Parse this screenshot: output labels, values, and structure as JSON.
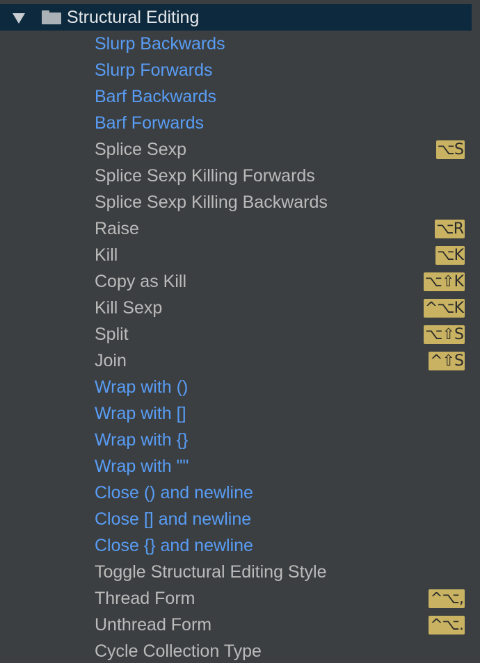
{
  "group": {
    "title": "Structural Editing",
    "expand_icon": "triangle-down",
    "folder_icon": "folder"
  },
  "colors": {
    "header_bg": "#0d293e",
    "panel_bg": "#3c3f41",
    "modified_text": "#589df6",
    "normal_text": "#bbbbbb",
    "shortcut_bg": "#c9b362"
  },
  "actions": [
    {
      "label": "Slurp Backwards",
      "modified": true,
      "shortcut": ""
    },
    {
      "label": "Slurp Forwards",
      "modified": true,
      "shortcut": ""
    },
    {
      "label": "Barf Backwards",
      "modified": true,
      "shortcut": ""
    },
    {
      "label": "Barf Forwards",
      "modified": true,
      "shortcut": ""
    },
    {
      "label": "Splice Sexp",
      "modified": false,
      "shortcut": "⌥S"
    },
    {
      "label": "Splice Sexp Killing Forwards",
      "modified": false,
      "shortcut": ""
    },
    {
      "label": "Splice Sexp Killing Backwards",
      "modified": false,
      "shortcut": ""
    },
    {
      "label": "Raise",
      "modified": false,
      "shortcut": "⌥R"
    },
    {
      "label": "Kill",
      "modified": false,
      "shortcut": "⌥K"
    },
    {
      "label": "Copy as Kill",
      "modified": false,
      "shortcut": "⌥⇧K"
    },
    {
      "label": "Kill Sexp",
      "modified": false,
      "shortcut": "^⌥K"
    },
    {
      "label": "Split",
      "modified": false,
      "shortcut": "⌥⇧S"
    },
    {
      "label": "Join",
      "modified": false,
      "shortcut": "^⇧S"
    },
    {
      "label": "Wrap with ()",
      "modified": true,
      "shortcut": ""
    },
    {
      "label": "Wrap with []",
      "modified": true,
      "shortcut": ""
    },
    {
      "label": "Wrap with {}",
      "modified": true,
      "shortcut": ""
    },
    {
      "label": "Wrap with \"\"",
      "modified": true,
      "shortcut": ""
    },
    {
      "label": "Close () and newline",
      "modified": true,
      "shortcut": ""
    },
    {
      "label": "Close [] and newline",
      "modified": true,
      "shortcut": ""
    },
    {
      "label": "Close {} and newline",
      "modified": true,
      "shortcut": ""
    },
    {
      "label": "Toggle Structural Editing Style",
      "modified": false,
      "shortcut": ""
    },
    {
      "label": "Thread Form",
      "modified": false,
      "shortcut": "^⌥,"
    },
    {
      "label": "Unthread Form",
      "modified": false,
      "shortcut": "^⌥."
    },
    {
      "label": "Cycle Collection Type",
      "modified": false,
      "shortcut": ""
    }
  ]
}
